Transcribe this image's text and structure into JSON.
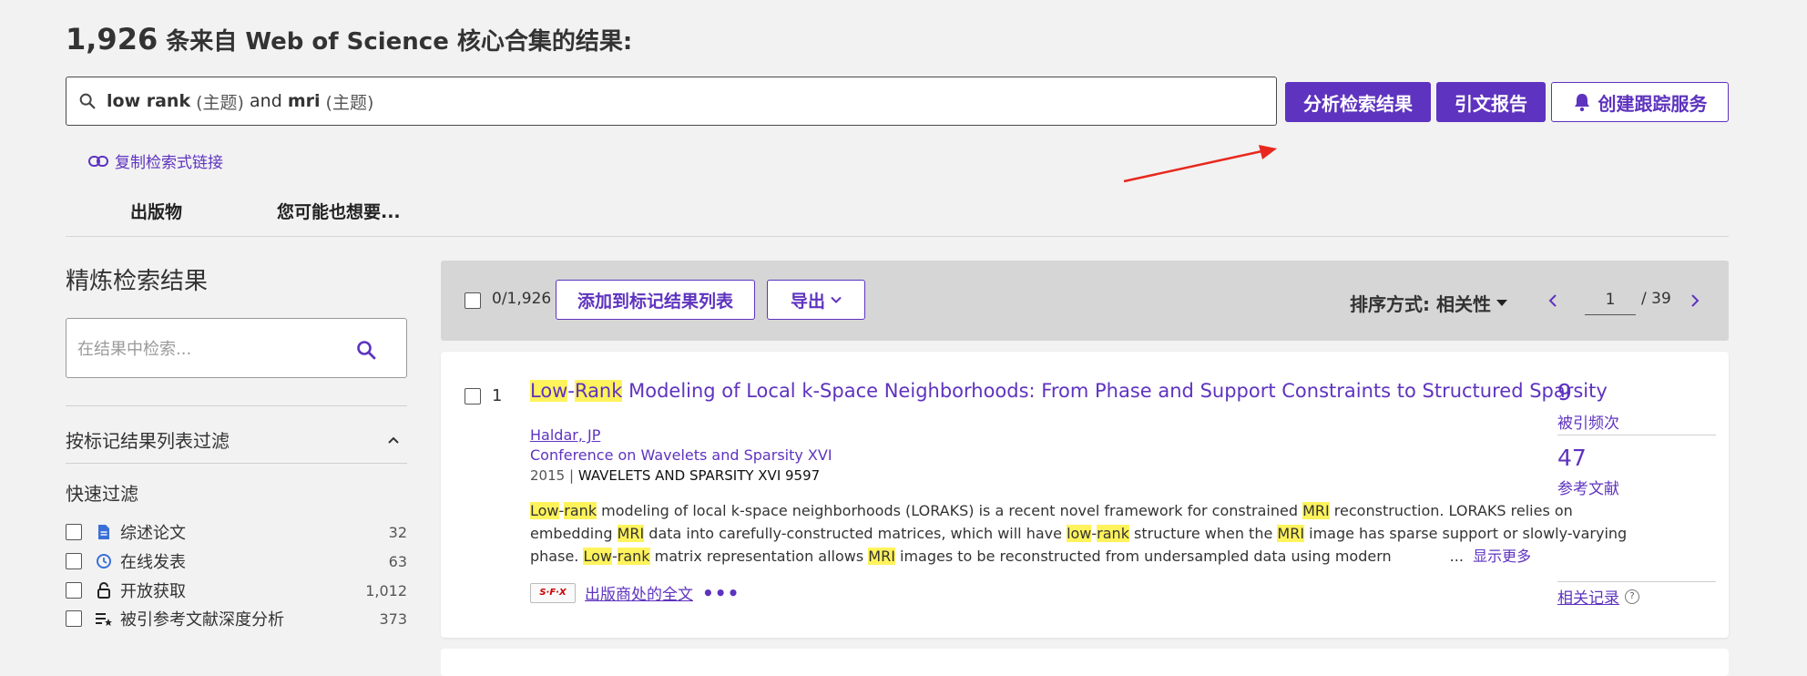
{
  "header": {
    "count": "1,926",
    "title_suffix": "条来自 Web of Science 核心合集的结果:"
  },
  "query": {
    "term1": "low rank",
    "field1": "(主题)",
    "op": "and",
    "term2": "mri",
    "field2": "(主题)"
  },
  "actions": {
    "analyze": "分析检索结果",
    "citation_report": "引文报告",
    "alert": "创建跟踪服务",
    "copy_link": "复制检索式链接"
  },
  "tabs": [
    "出版物",
    "您可能也想要..."
  ],
  "refine": {
    "title": "精炼检索结果",
    "placeholder": "在结果中检索...",
    "marked_filter": "按标记结果列表过滤",
    "quick_filter": "快速过滤",
    "quick_items": [
      {
        "label": "综述论文",
        "count": "32",
        "icon": "document-icon"
      },
      {
        "label": "在线发表",
        "count": "63",
        "icon": "clock-icon"
      },
      {
        "label": "开放获取",
        "count": "1,012",
        "icon": "lock-open-icon"
      },
      {
        "label": "被引参考文献深度分析",
        "count": "373",
        "icon": "list-star-icon"
      }
    ]
  },
  "toolbar": {
    "selected": "0/1,926",
    "add_to_marked": "添加到标记结果列表",
    "export": "导出",
    "sort": "排序方式: 相关性",
    "page": "1",
    "total_pages": "/ 39"
  },
  "result": {
    "index": "1",
    "title_hl1": "Low",
    "title_sep": "-",
    "title_hl2": "Rank",
    "title_rest": " Modeling of Local k-Space Neighborhoods: From Phase and Support Constraints to Structured Sparsity",
    "author": "Haldar, JP",
    "conference": "Conference on Wavelets and Sparsity XVI",
    "year": "2015",
    "source": "WAVELETS AND SPARSITY XVI 9597",
    "abstract": {
      "l1": [
        {
          "h": "Low"
        },
        {
          "t": "-"
        },
        {
          "h": "rank"
        },
        {
          "t": " modeling of local k-space neighborhoods (LORAKS) is a recent novel framework for constrained "
        },
        {
          "h": "MRI"
        },
        {
          "t": " reconstruction. LORAKS relies on"
        }
      ],
      "l2": [
        {
          "t": "embedding "
        },
        {
          "h": "MRI"
        },
        {
          "t": " data into carefully-constructed matrices, which will have "
        },
        {
          "h": "low"
        },
        {
          "t": "-"
        },
        {
          "h": "rank"
        },
        {
          "t": " structure when the "
        },
        {
          "h": "MRI"
        },
        {
          "t": " image has sparse support or slowly-varying"
        }
      ],
      "l3": [
        {
          "t": "phase. "
        },
        {
          "h": "Low"
        },
        {
          "t": "-"
        },
        {
          "h": "rank"
        },
        {
          "t": " matrix representation allows "
        },
        {
          "h": "MRI"
        },
        {
          "t": " images to be reconstructed from undersampled data using modern"
        }
      ],
      "ellipsis": "...",
      "show_more": "显示更多"
    },
    "sfx": "S·F·X",
    "full_text": "出版商处的全文",
    "more_dots": "•••",
    "citations": "9",
    "citations_label": "被引频次",
    "references": "47",
    "references_label": "参考文献",
    "related": "相关记录",
    "related_help": "?"
  },
  "colors": {
    "accent": "#5e33bf",
    "highlight": "#fff35c",
    "annotation_arrow": "#e8281e"
  }
}
